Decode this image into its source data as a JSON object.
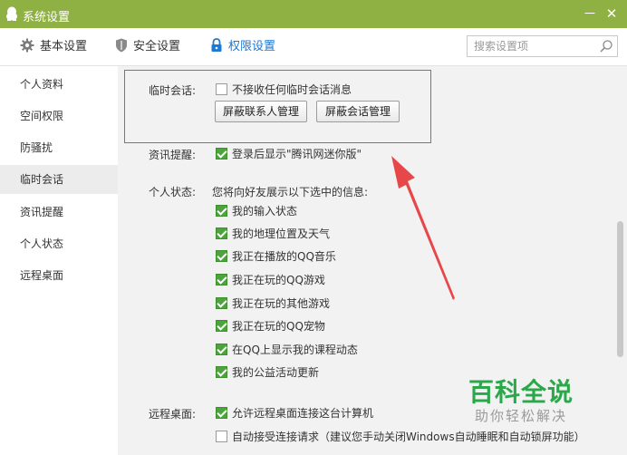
{
  "window": {
    "title": "系统设置",
    "minimize_label": "－",
    "close_label": "✕"
  },
  "tabs": [
    {
      "label": "基本设置",
      "icon": "gear-icon"
    },
    {
      "label": "安全设置",
      "icon": "shield-icon"
    },
    {
      "label": "权限设置",
      "icon": "lock-icon",
      "active": true
    }
  ],
  "search": {
    "placeholder": "搜索设置项",
    "value": ""
  },
  "sidebar": {
    "items": [
      {
        "label": "个人资料"
      },
      {
        "label": "空间权限"
      },
      {
        "label": "防骚扰"
      },
      {
        "label": "临时会话",
        "active": true
      },
      {
        "label": "资讯提醒"
      },
      {
        "label": "个人状态"
      },
      {
        "label": "远程桌面"
      }
    ]
  },
  "temp_session": {
    "label": "临时会话:",
    "checkbox_label": "不接收任何临时会话消息",
    "checked": false,
    "btn_contacts": "屏蔽联系人管理",
    "btn_sessions": "屏蔽会话管理"
  },
  "news": {
    "label": "资讯提醒:",
    "checkbox_label": "登录后显示\"腾讯网迷你版\"",
    "checked": true
  },
  "status": {
    "label": "个人状态:",
    "description": "您将向好友展示以下选中的信息:",
    "items": [
      {
        "label": "我的输入状态",
        "checked": true
      },
      {
        "label": "我的地理位置及天气",
        "checked": true
      },
      {
        "label": "我正在播放的QQ音乐",
        "checked": true
      },
      {
        "label": "我正在玩的QQ游戏",
        "checked": true
      },
      {
        "label": "我正在玩的其他游戏",
        "checked": true
      },
      {
        "label": "我正在玩的QQ宠物",
        "checked": true
      },
      {
        "label": "在QQ上显示我的课程动态",
        "checked": true
      },
      {
        "label": "我的公益活动更新",
        "checked": true
      }
    ]
  },
  "remote": {
    "label": "远程桌面:",
    "allow_label": "允许远程桌面连接这台计算机",
    "allow_checked": true,
    "auto_label": "自动接受连接请求（建议您手动关闭Windows自动睡眠和自动锁屏功能）",
    "auto_checked": false
  },
  "watermark": {
    "main": "百科全说",
    "sub": "助你轻松解决"
  },
  "colors": {
    "titlebar": "#8fb042",
    "active_tab": "#1a78d6",
    "checkbox_checked": "#4da33c",
    "annotation_red": "#e24a4a",
    "watermark_green": "#2aa84a"
  }
}
